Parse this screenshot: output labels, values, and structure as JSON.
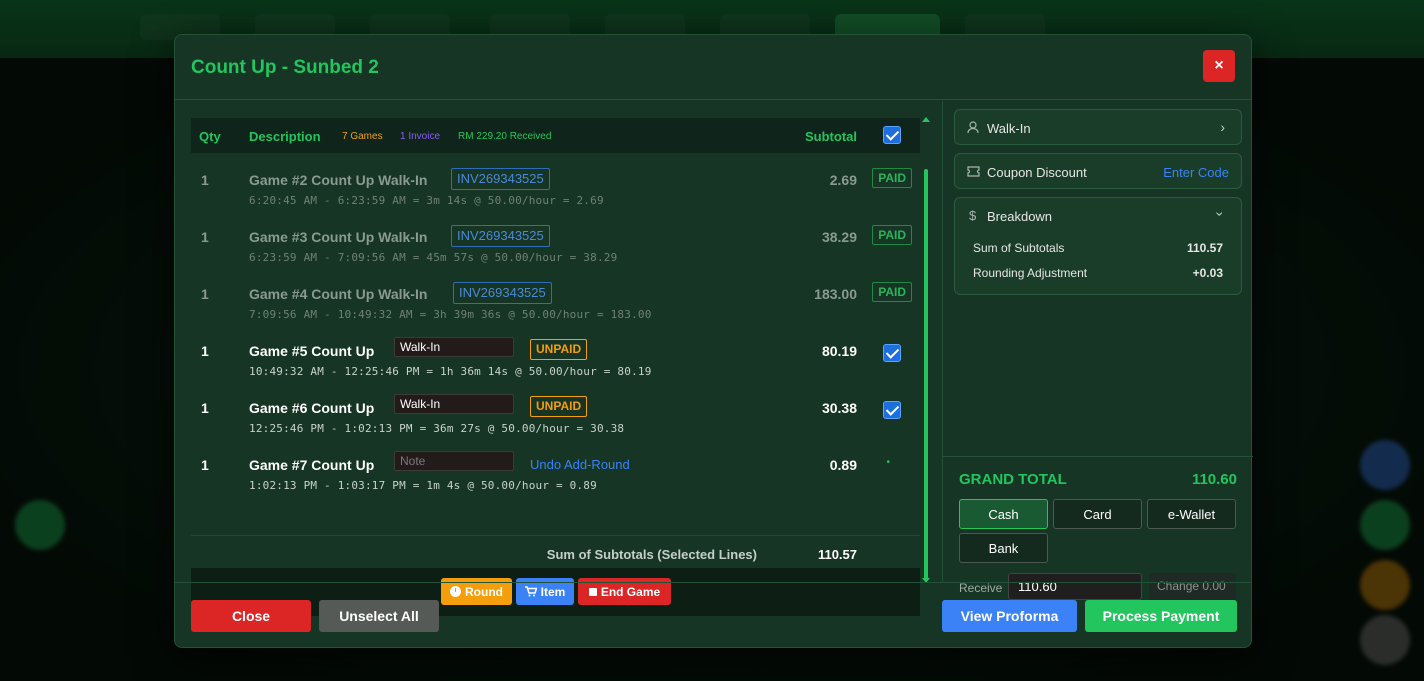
{
  "modal": {
    "title": "Count Up - Sunbed 2",
    "close_icon": "×"
  },
  "table": {
    "headers": {
      "qty": "Qty",
      "description": "Description",
      "subtotal": "Subtotal"
    },
    "stats": {
      "games": "7 Games",
      "invoices": "1 Invoice",
      "received": "RM 229.20 Received"
    },
    "rows": [
      {
        "qty": "1",
        "title": "Game #2  Count Up  Walk-In",
        "invoice": "INV269343525",
        "formula": "6:20:45 AM - 6:23:59 AM = 3m 14s @ 50.00/hour = 2.69",
        "amount": "2.69",
        "status": "PAID"
      },
      {
        "qty": "1",
        "title": "Game #3  Count Up  Walk-In",
        "invoice": "INV269343525",
        "formula": "6:23:59 AM - 7:09:56 AM = 45m 57s @ 50.00/hour = 38.29",
        "amount": "38.29",
        "status": "PAID"
      },
      {
        "qty": "1",
        "title": "Game #4  Count Up  Walk-In",
        "invoice": "INV269343525",
        "formula": "7:09:56 AM - 10:49:32 AM = 3h 39m 36s @ 50.00/hour = 183.00",
        "amount": "183.00",
        "status": "PAID"
      },
      {
        "qty": "1",
        "title": "Game #5  Count Up",
        "note": "Walk-In",
        "badge": "UNPAID",
        "formula": "10:49:32 AM - 12:25:46 PM = 1h 36m 14s @ 50.00/hour = 80.19",
        "amount": "80.19"
      },
      {
        "qty": "1",
        "title": "Game #6  Count Up",
        "note": "Walk-In",
        "badge": "UNPAID",
        "formula": "12:25:46 PM - 1:02:13 PM = 36m 27s @ 50.00/hour = 30.38",
        "amount": "30.38"
      },
      {
        "qty": "1",
        "title": "Game #7  Count Up",
        "note_placeholder": "Note",
        "link": "Undo Add-Round",
        "formula": "1:02:13 PM - 1:03:17 PM = 1m 4s @ 50.00/hour = 0.89",
        "amount": "0.89"
      }
    ],
    "sum_label": "Sum of Subtotals (Selected Lines)",
    "sum_value": "110.57"
  },
  "actions": {
    "round": "Round",
    "item": "Item",
    "end_game": "End Game"
  },
  "customer": {
    "label": "Walk-In"
  },
  "coupon": {
    "label": "Coupon Discount",
    "link": "Enter Code"
  },
  "breakdown": {
    "title": "Breakdown",
    "sum_label": "Sum of Subtotals",
    "sum_value": "110.57",
    "rounding_label": "Rounding Adjustment",
    "rounding_value": "+0.03"
  },
  "payment": {
    "grand_label": "GRAND TOTAL",
    "grand_value": "110.60",
    "methods": [
      "Cash",
      "Card",
      "e-Wallet",
      "Bank"
    ],
    "selected": "Cash",
    "receive_label": "Receive",
    "receive_value": "110.60",
    "change": "Change 0.00"
  },
  "footer": {
    "close": "Close",
    "unselect_all": "Unselect All",
    "view_proforma": "View Proforma",
    "process_payment": "Process Payment"
  },
  "colors": {
    "accent": "#22c55e",
    "danger": "#dc2626",
    "primary": "#3b82f6",
    "warning": "#f59e0b"
  }
}
